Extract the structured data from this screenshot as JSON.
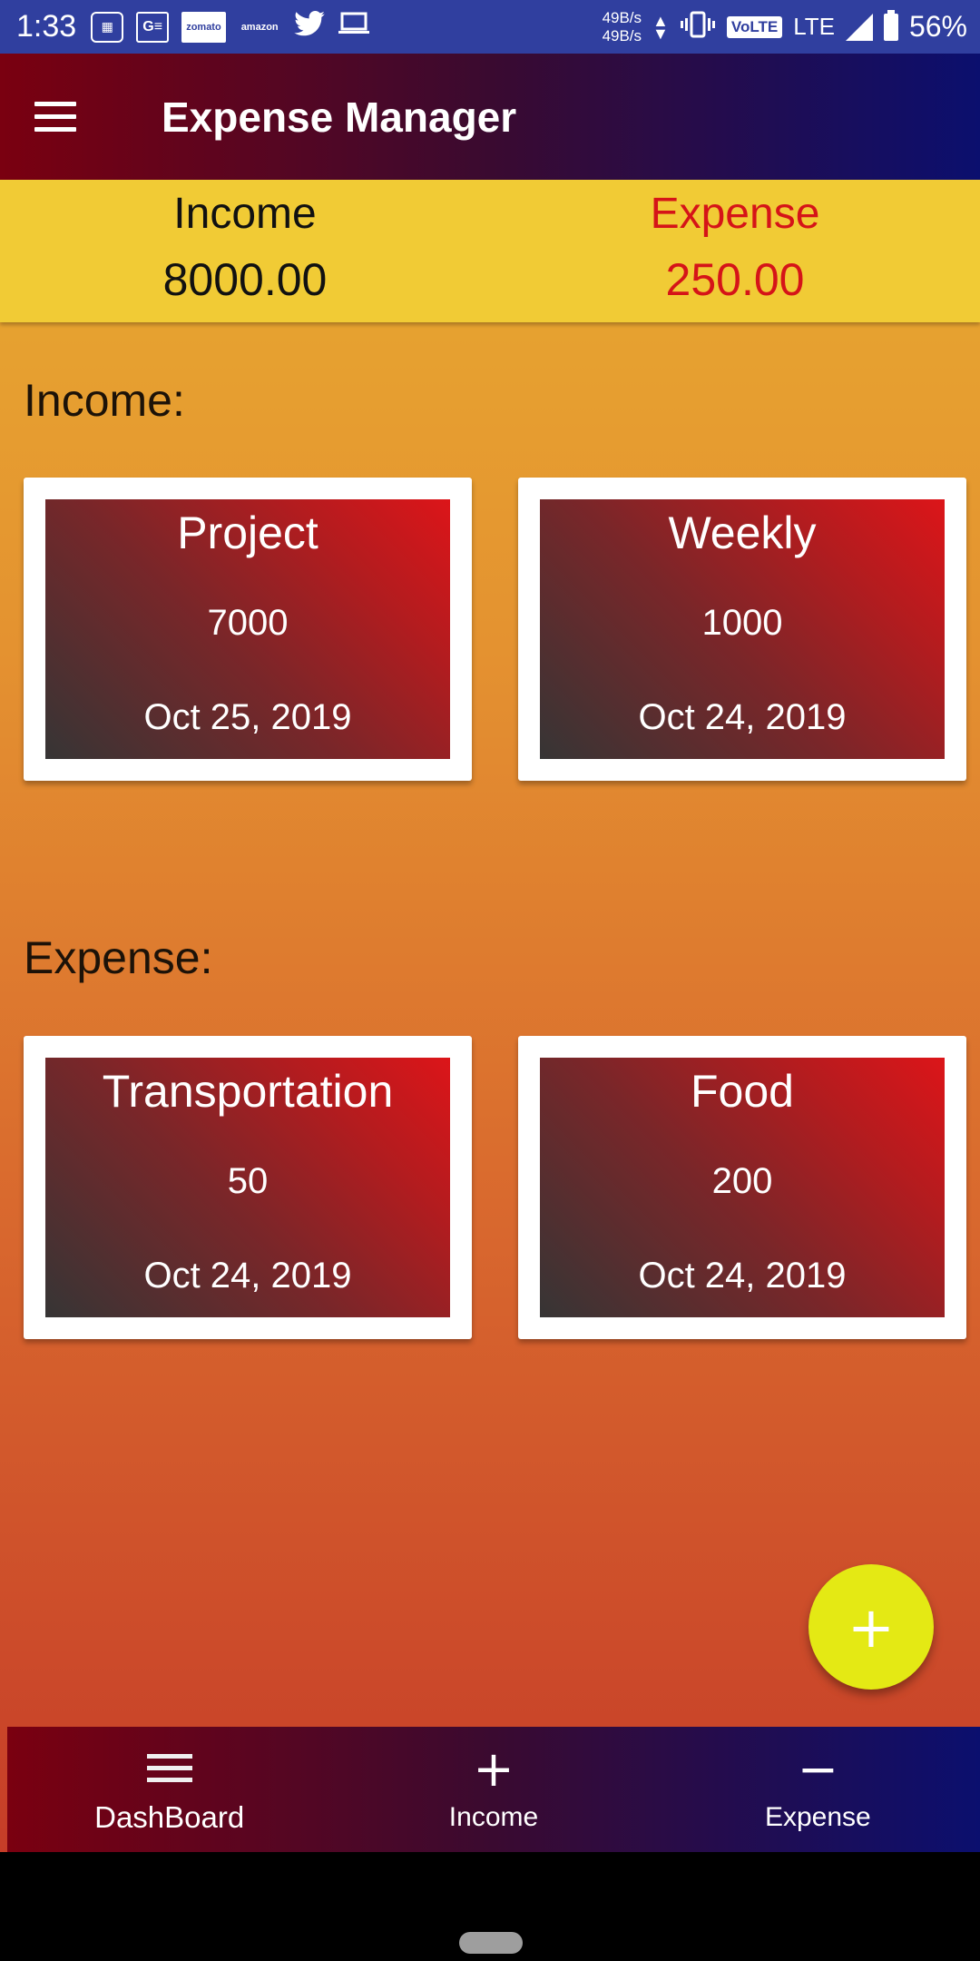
{
  "status_bar": {
    "time": "1:33",
    "notif_icons": [
      "calculator-icon",
      "ge-icon",
      "zomato-icon",
      "amazon-icon",
      "twitter-icon",
      "laptop-icon"
    ],
    "zomato_text": "zomato",
    "amazon_text": "amazon",
    "net_up": "49B/s",
    "net_down": "49B/s",
    "volte": "VoLTE",
    "network": "LTE",
    "battery": "56%"
  },
  "app_bar": {
    "title": "Expense Manager"
  },
  "summary": {
    "income_label": "Income",
    "income_value": "8000.00",
    "expense_label": "Expense",
    "expense_value": "250.00",
    "colors": {
      "income": "#111111",
      "expense": "#d51418",
      "background": "#f1cb35"
    }
  },
  "income_section": {
    "title": "Income:",
    "cards": [
      {
        "title": "Project",
        "amount": "7000",
        "date": "Oct 25, 2019"
      },
      {
        "title": "Weekly",
        "amount": "1000",
        "date": "Oct 24, 2019"
      }
    ]
  },
  "expense_section": {
    "title": "Expense:",
    "cards": [
      {
        "title": "Transportation",
        "amount": "50",
        "date": "Oct 24, 2019"
      },
      {
        "title": "Food",
        "amount": "200",
        "date": "Oct 24, 2019"
      }
    ]
  },
  "fab": {
    "icon": "plus-icon",
    "symbol": "+",
    "color": "#e4e914"
  },
  "bottom_nav": {
    "items": [
      {
        "label": "DashBoard",
        "icon": "dashboard-lines-icon"
      },
      {
        "label": "Income",
        "icon": "plus-icon",
        "symbol": "+"
      },
      {
        "label": "Expense",
        "icon": "minus-icon",
        "symbol": "−"
      }
    ]
  }
}
